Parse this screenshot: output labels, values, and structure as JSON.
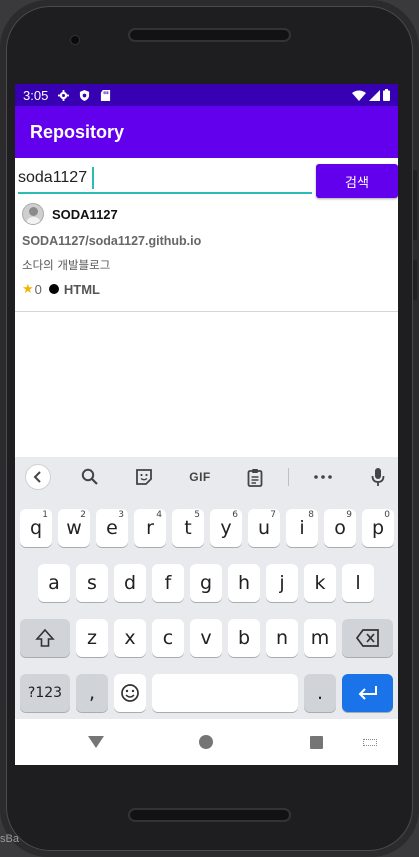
{
  "status_bar": {
    "time": "3:05",
    "icons": [
      "settings-icon",
      "shield-icon",
      "sd-card-icon",
      "wifi-icon",
      "signal-icon",
      "battery-icon"
    ]
  },
  "app_bar": {
    "title": "Repository"
  },
  "search": {
    "value": "soda1127",
    "button_label": "검색"
  },
  "results": [
    {
      "owner": "SODA1127",
      "full_name": "SODA1127/soda1127.github.io",
      "description": "소다의 개발블로그",
      "stars": "0",
      "language": "HTML",
      "language_color": "#000000"
    }
  ],
  "keyboard": {
    "toolbar": [
      "back-icon",
      "search-icon",
      "sticker-icon",
      "GIF",
      "clipboard-icon",
      "more-icon",
      "mic-icon"
    ],
    "row1": [
      {
        "k": "q",
        "h": "1"
      },
      {
        "k": "w",
        "h": "2"
      },
      {
        "k": "e",
        "h": "3"
      },
      {
        "k": "r",
        "h": "4"
      },
      {
        "k": "t",
        "h": "5"
      },
      {
        "k": "y",
        "h": "6"
      },
      {
        "k": "u",
        "h": "7"
      },
      {
        "k": "i",
        "h": "8"
      },
      {
        "k": "o",
        "h": "9"
      },
      {
        "k": "p",
        "h": "0"
      }
    ],
    "row2": [
      "a",
      "s",
      "d",
      "f",
      "g",
      "h",
      "j",
      "k",
      "l"
    ],
    "row3": [
      "z",
      "x",
      "c",
      "v",
      "b",
      "n",
      "m"
    ],
    "bottom": {
      "symbols": "?123",
      "comma": ",",
      "period": "."
    }
  },
  "colors": {
    "primary": "#6200ee",
    "primary_dark": "#3700b3",
    "accent": "#2bbdb4",
    "star": "#f5b301",
    "enter_key": "#1a73e8"
  },
  "outside": {
    "taskbar_fragment": "sBa"
  }
}
